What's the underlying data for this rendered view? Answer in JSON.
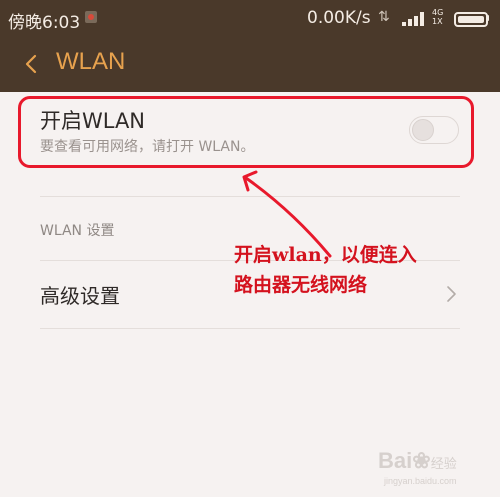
{
  "status_bar": {
    "time": "傍晚6:03",
    "net_speed": "0.00K/s",
    "network_type": "4G",
    "sim_slot": "1X"
  },
  "header": {
    "title": "WLAN"
  },
  "wlan_toggle": {
    "title": "开启WLAN",
    "subtitle": "要查看可用网络，请打开 WLAN。",
    "state": "off"
  },
  "settings_section": {
    "header": "WLAN 设置",
    "items": [
      {
        "label": "高级设置"
      }
    ]
  },
  "annotation": {
    "line1": "开启wlan，以便连入",
    "line2": "路由器无线网络",
    "color": "#d4121e"
  },
  "watermark": {
    "main": "Bai",
    "mid": "经验",
    "sub": "jingyan.baidu.com"
  },
  "colors": {
    "bar_background": "#4a392a",
    "accent": "#e7a24e",
    "page_background": "#f6f2f1"
  }
}
